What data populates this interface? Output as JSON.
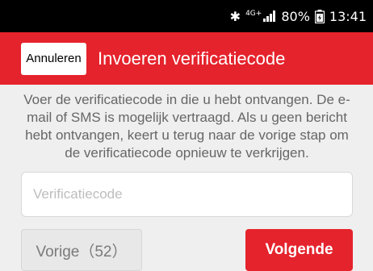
{
  "status_bar": {
    "bluetooth_icon": "✱",
    "network": "4G+",
    "battery": "80%",
    "time": "13:41"
  },
  "header": {
    "cancel_label": "Annuleren",
    "title": "Invoeren verificatiecode",
    "accent_color": "#e5232c"
  },
  "main": {
    "description": "Voer de verificatiecode in die u hebt ontvangen. De e-mail of SMS is mogelijk vertraagd. Als u geen bericht hebt ontvangen, keert u terug naar de vorige stap om de verificatiecode opnieuw te verkrijgen.",
    "code_input": {
      "placeholder": "Verificatiecode",
      "value": ""
    },
    "prev_label": "Vorige（52）",
    "next_label": "Volgende"
  }
}
